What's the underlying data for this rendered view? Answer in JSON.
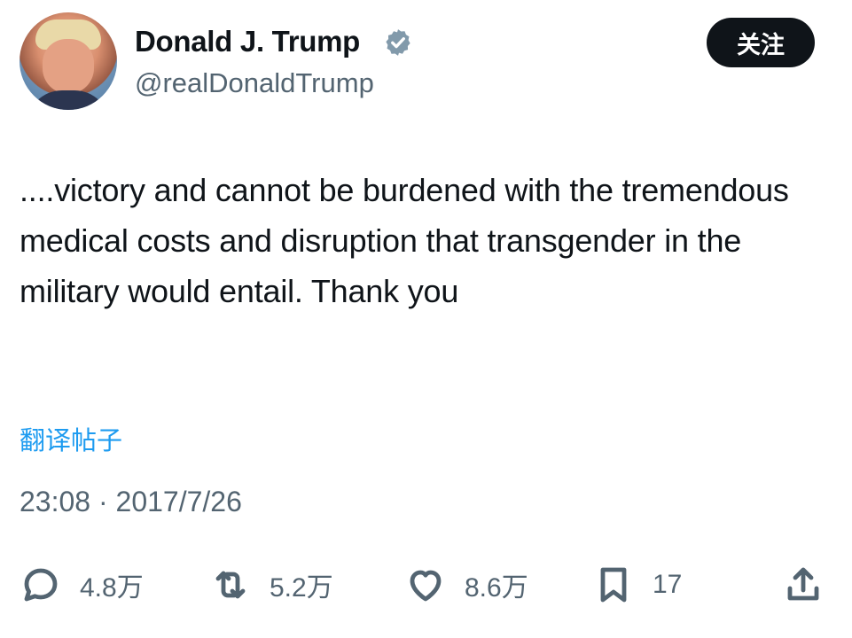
{
  "user": {
    "display_name": "Donald J. Trump",
    "handle": "@realDonaldTrump",
    "verified_icon": "verified-badge-icon",
    "follow_label": "关注"
  },
  "tweet": {
    "text": "....victory and cannot be burdened with the tremendous medical costs and disruption that transgender in the military would entail. Thank you",
    "translate_label": "翻译帖子",
    "timestamp": "23:08 · 2017/7/26"
  },
  "actions": {
    "reply_count": "4.8万",
    "retweet_count": "5.2万",
    "like_count": "8.6万",
    "bookmark_count": "17"
  },
  "colors": {
    "text": "#0f1419",
    "secondary": "#536471",
    "link": "#1d9bf0",
    "verified": "#829aab",
    "button_bg": "#0f1419"
  }
}
